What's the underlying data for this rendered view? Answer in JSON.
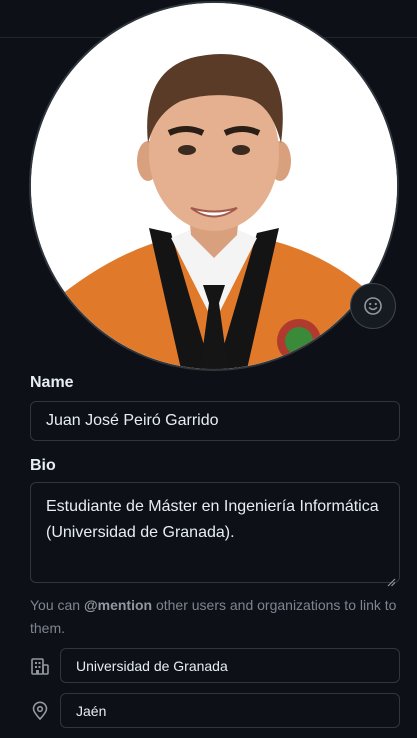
{
  "profile": {
    "name_label": "Name",
    "name_value": "Juan José Peiró Garrido",
    "bio_label": "Bio",
    "bio_value": "Estudiante de Máster en Ingeniería Informática (Universidad de Granada).",
    "hint_mention": "@mention",
    "hint_before": "You can ",
    "hint_after": " other users and organizations to link to them.",
    "company_value": "Universidad de Granada",
    "location_value": "Jaén"
  },
  "icons": {
    "emoji": "smiley-icon",
    "company": "organization-icon",
    "location": "location-pin-icon"
  },
  "colors": {
    "background": "#0d1117",
    "border": "#30363d",
    "text": "#e6edf3",
    "muted": "#7d8590"
  }
}
